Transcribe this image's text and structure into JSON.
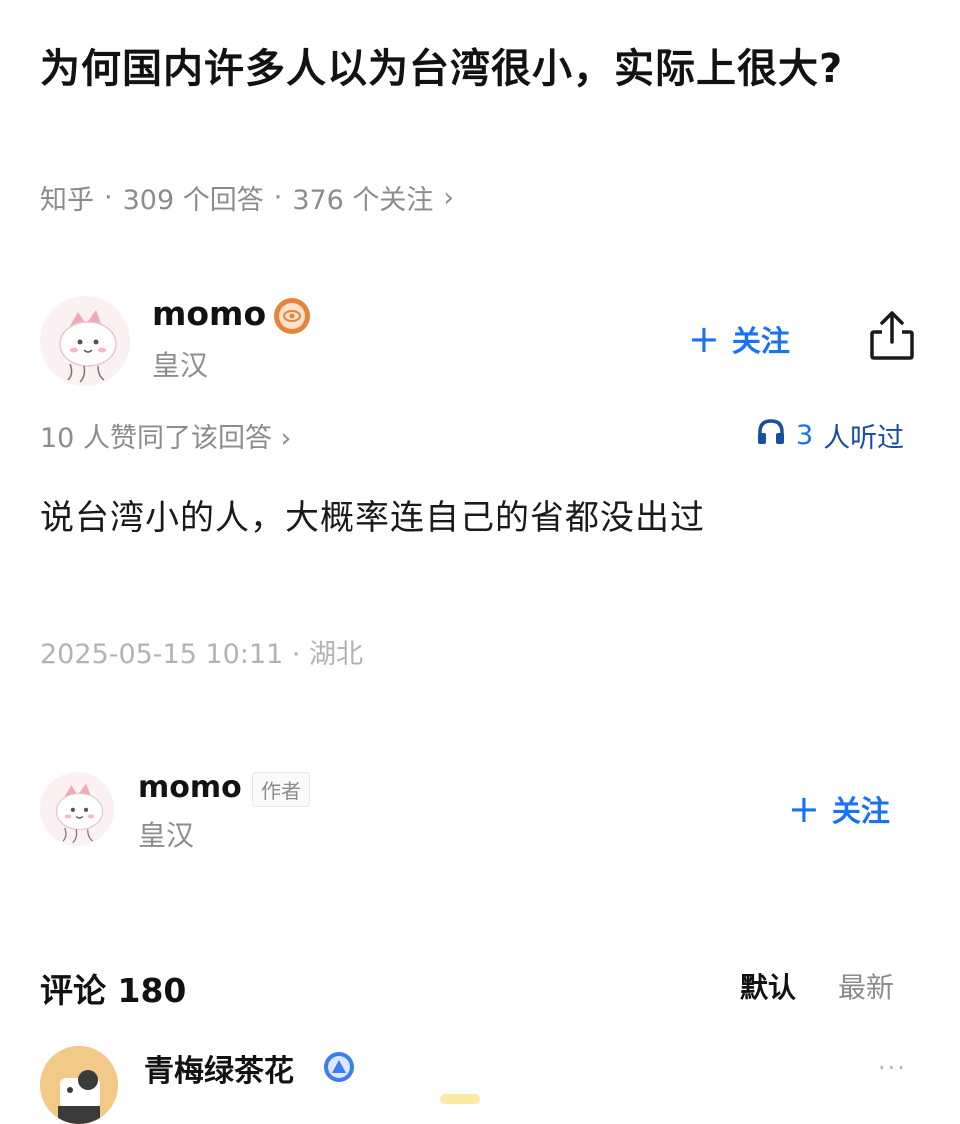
{
  "question": {
    "title": "为何国内许多人以为台湾很小，实际上很大?",
    "source": "知乎",
    "answers": "309 个回答",
    "followers": "376 个关注",
    "separator": "·",
    "chevron": "›"
  },
  "answer_author": {
    "name": "momo",
    "subtitle": "皇汉",
    "badge_icon": "orange-badge-icon",
    "follow_plus": "+",
    "follow_label": "关注",
    "share_icon": "share-icon"
  },
  "answer": {
    "votes": "10 人赞同了该回答 ›",
    "listen_icon": "headphones-icon",
    "listen_count": "3",
    "listen_label": "人听过",
    "content": "说台湾小的人，大概率连自己的省都没出过",
    "timestamp": "2025-05-15 10:11 · 湖北"
  },
  "author_card": {
    "name": "momo",
    "tag": "作者",
    "subtitle": "皇汉",
    "follow_plus": "+",
    "follow_label": "关注"
  },
  "comments": {
    "title": "评论 180",
    "sort_default": "默认",
    "sort_new": "最新",
    "first_comment": {
      "name": "青梅绿茶花",
      "badge_icon": "blue-triangle-badge-icon",
      "more": "···"
    }
  },
  "colors": {
    "accent": "#1772f6",
    "muted": "#8c8c8c",
    "badge": "#e8833a"
  }
}
